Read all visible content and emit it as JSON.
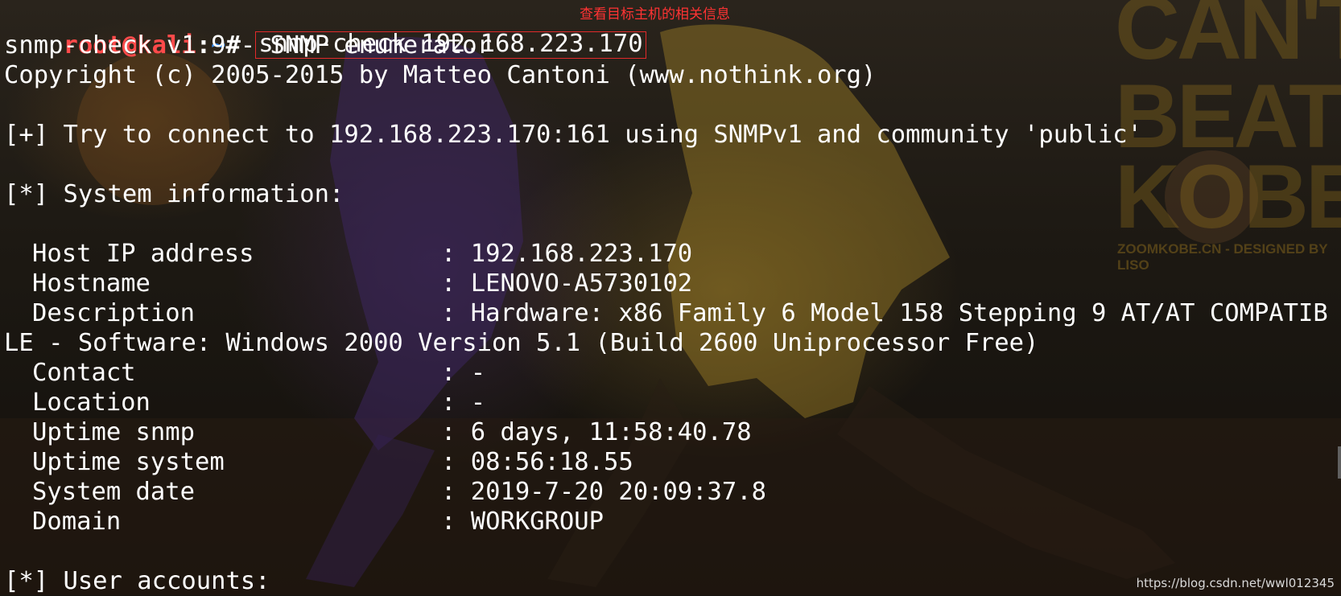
{
  "prompt": {
    "user_host": "root@kali",
    "separator": ":",
    "path": "~",
    "symbol": "#",
    "command": "snmp-check 192.168.223.170"
  },
  "annotation": "查看目标主机的相关信息",
  "header": {
    "version_line": "snmp-check v1.9 - SNMP enumerator",
    "copyright_line": "Copyright (c) 2005-2015 by Matteo Cantoni (www.nothink.org)",
    "connect_line": "[+] Try to connect to 192.168.223.170:161 using SNMPv1 and community 'public'",
    "system_section": "[*] System information:"
  },
  "system_info": [
    {
      "label": "Host IP address",
      "value": "192.168.223.170"
    },
    {
      "label": "Hostname",
      "value": "LENOVO-A5730102"
    },
    {
      "label": "Description",
      "value": "Hardware: x86 Family 6 Model 158 Stepping 9 AT/AT COMPATIB"
    },
    {
      "label": "Contact",
      "value": "-"
    },
    {
      "label": "Location",
      "value": "-"
    },
    {
      "label": "Uptime snmp",
      "value": "6 days, 11:58:40.78"
    },
    {
      "label": "Uptime system",
      "value": "08:56:18.55"
    },
    {
      "label": "System date",
      "value": "2019-7-20 20:09:37.8"
    },
    {
      "label": "Domain",
      "value": "WORKGROUP"
    }
  ],
  "description_wrap": "LE - Software: Windows 2000 Version 5.1 (Build 2600 Uniprocessor Free)",
  "user_section": "[*] User accounts:",
  "colon_sep": ": ",
  "wallpaper_text": {
    "line1": "CAN'T",
    "line2": "BEAT",
    "line3": "KOBE",
    "credit": "ZOOMKOBE.CN - DESIGNED BY LISO"
  },
  "watermark": "https://blog.csdn.net/wwl012345",
  "colors": {
    "user": "#ff4a4a",
    "path": "#3b8ff5",
    "text": "#ffffff",
    "annotation": "#ff3333"
  }
}
